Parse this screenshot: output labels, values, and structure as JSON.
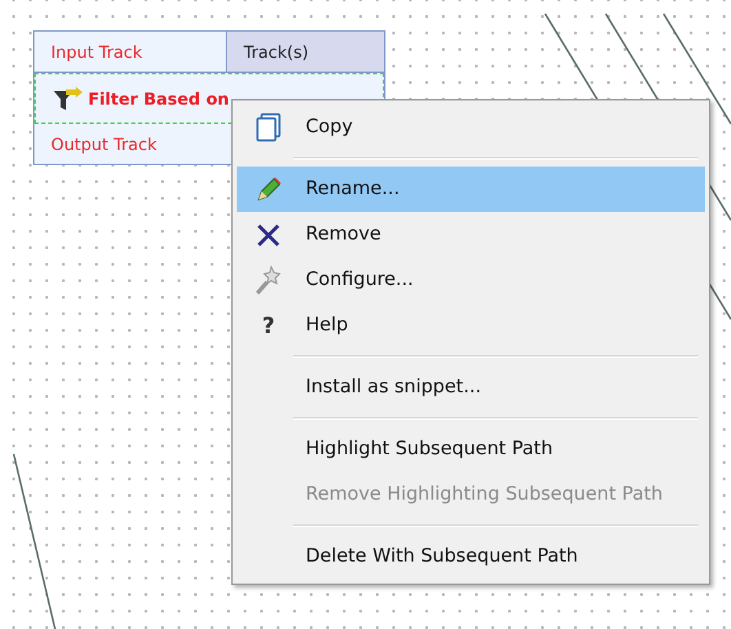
{
  "node": {
    "input_label": "Input Track",
    "input_type": "Track(s)",
    "title": "Filter Based on",
    "output_label": "Output Track"
  },
  "context_menu": {
    "items": [
      {
        "kind": "item",
        "label": "Copy",
        "selected": false,
        "disabled": false
      },
      {
        "kind": "separator"
      },
      {
        "kind": "item",
        "label": "Rename...",
        "selected": true,
        "disabled": false
      },
      {
        "kind": "item",
        "label": "Remove",
        "selected": false,
        "disabled": false
      },
      {
        "kind": "item",
        "label": "Configure...",
        "selected": false,
        "disabled": false
      },
      {
        "kind": "item",
        "label": "Help",
        "glyph": "?",
        "selected": false,
        "disabled": false
      },
      {
        "kind": "separator"
      },
      {
        "kind": "item",
        "label": "Install as snippet...",
        "selected": false,
        "disabled": false
      },
      {
        "kind": "separator"
      },
      {
        "kind": "item",
        "label": "Highlight Subsequent Path",
        "selected": false,
        "disabled": false
      },
      {
        "kind": "item",
        "label": "Remove Highlighting Subsequent Path",
        "selected": false,
        "disabled": true
      },
      {
        "kind": "separator"
      },
      {
        "kind": "item",
        "label": "Delete With Subsequent Path",
        "selected": false,
        "disabled": false
      }
    ]
  }
}
